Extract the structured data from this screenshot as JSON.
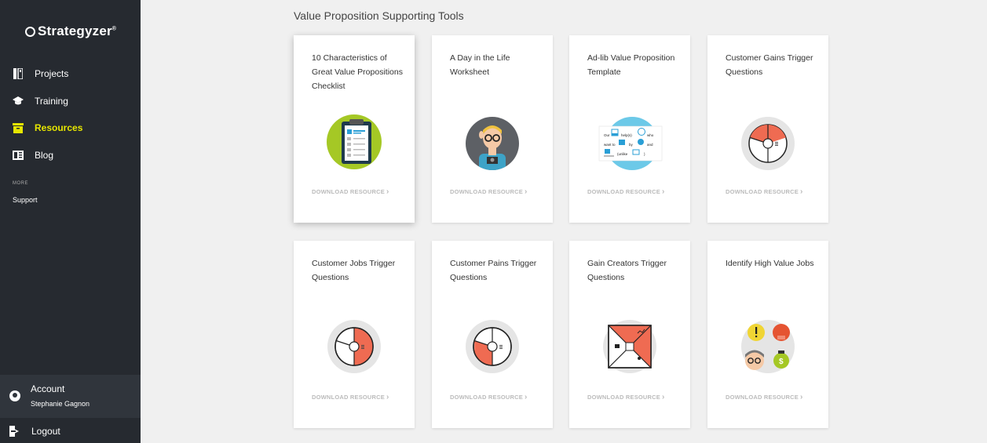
{
  "sidebar": {
    "logo": "Strategyzer",
    "items": [
      {
        "label": "Projects",
        "icon": "projects-icon"
      },
      {
        "label": "Training",
        "icon": "graduation-cap-icon"
      },
      {
        "label": "Resources",
        "icon": "archive-box-icon"
      },
      {
        "label": "Blog",
        "icon": "blog-icon"
      }
    ],
    "more_label": "MORE",
    "support": "Support",
    "account": {
      "label": "Account",
      "name": "Stephanie Gagnon"
    },
    "logout": "Logout",
    "active_color": "#e6e600"
  },
  "main": {
    "section_title": "Value Proposition Supporting Tools",
    "download_label": "DOWNLOAD RESOURCE",
    "cards": [
      {
        "title": "10 Characteristics of Great Value Propositions Checklist",
        "icon": "checklist-icon"
      },
      {
        "title": "A Day in the Life Worksheet",
        "icon": "person-icon"
      },
      {
        "title": "Ad-lib Value Proposition Template",
        "icon": "template-icon"
      },
      {
        "title": "Customer Gains Trigger Questions",
        "icon": "customer-profile-gains-icon"
      },
      {
        "title": "Customer Jobs Trigger Questions",
        "icon": "customer-profile-jobs-icon"
      },
      {
        "title": "Customer Pains Trigger Questions",
        "icon": "customer-profile-pains-icon"
      },
      {
        "title": "Gain Creators Trigger Questions",
        "icon": "value-map-gain-creators-icon"
      },
      {
        "title": "Identify High Value Jobs",
        "icon": "high-value-jobs-icon"
      }
    ],
    "ad_lib_words": {
      "w1": "Our",
      "w2": "help(s)",
      "w3": "who",
      "w4": "want to",
      "w5": "by",
      "w6": "and",
      "w7": "(unlike",
      "w8": ")"
    }
  }
}
